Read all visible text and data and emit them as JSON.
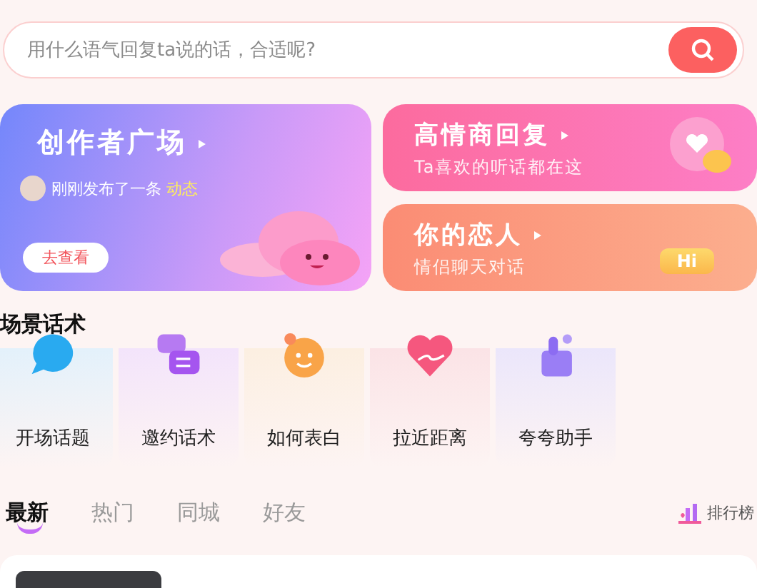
{
  "search": {
    "placeholder": "用什么语气回复ta说的话，合适呢?"
  },
  "feature_cards": [
    {
      "title": "创作者广场",
      "subtitle": "刚刚发布了一条",
      "highlight": "动态",
      "button": "去查看"
    }
  ],
  "side_cards": [
    {
      "title": "高情商回复",
      "subtitle": "Ta喜欢的听话都在这"
    },
    {
      "title": "你的恋人",
      "subtitle": "情侣聊天对话",
      "badge": "Hi"
    }
  ],
  "section_title": "场景话术",
  "scenes": [
    {
      "label": "开场话题"
    },
    {
      "label": "邀约话术"
    },
    {
      "label": "如何表白"
    },
    {
      "label": "拉近距离"
    },
    {
      "label": "夸夸助手"
    }
  ],
  "feed_tabs": [
    {
      "label": "最新",
      "selected": true
    },
    {
      "label": "热门",
      "selected": false
    },
    {
      "label": "同城",
      "selected": false
    },
    {
      "label": "好友",
      "selected": false
    }
  ],
  "ranking": {
    "label": "排行榜"
  }
}
